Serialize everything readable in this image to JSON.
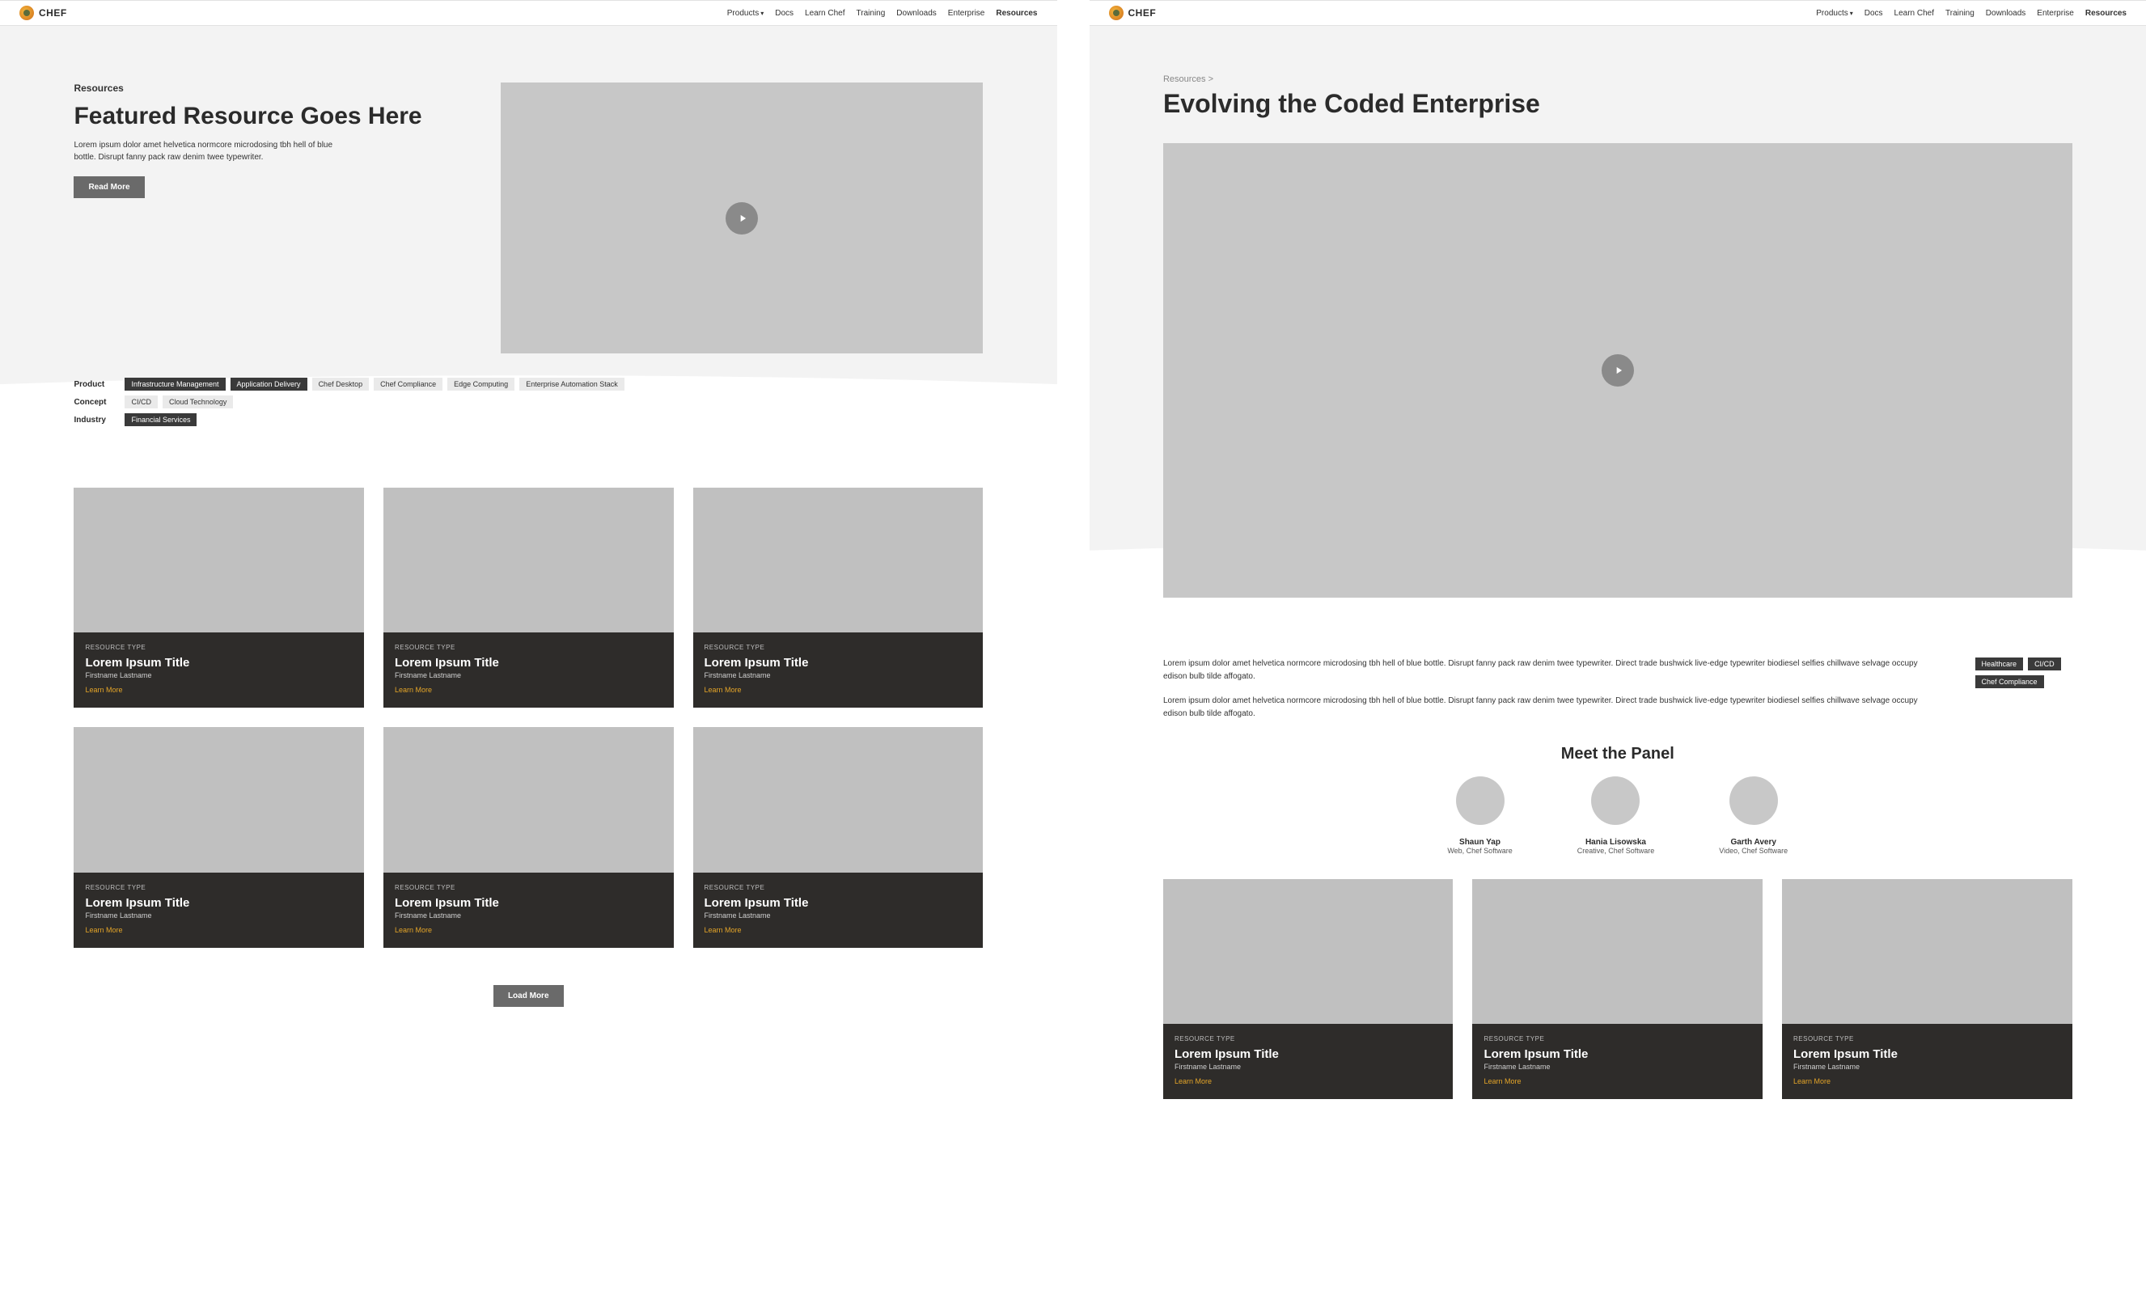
{
  "nav": {
    "brand": "CHEF",
    "links": [
      {
        "label": "Products",
        "hasCaret": true
      },
      {
        "label": "Docs"
      },
      {
        "label": "Learn Chef"
      },
      {
        "label": "Training"
      },
      {
        "label": "Downloads"
      },
      {
        "label": "Enterprise"
      },
      {
        "label": "Resources",
        "active": true
      }
    ]
  },
  "left": {
    "breadcrumb": "Resources",
    "title": "Featured Resource Goes Here",
    "lead": "Lorem ipsum dolor amet helvetica normcore microdosing tbh hell of blue bottle. Disrupt fanny pack raw denim twee typewriter.",
    "readMore": "Read More",
    "filters": {
      "product": {
        "label": "Product",
        "tags": [
          {
            "text": "Infrastructure Management",
            "dark": true
          },
          {
            "text": "Application Delivery",
            "dark": true
          },
          {
            "text": "Chef Desktop"
          },
          {
            "text": "Chef Compliance"
          },
          {
            "text": "Edge Computing"
          },
          {
            "text": "Enterprise Automation Stack"
          }
        ]
      },
      "concept": {
        "label": "Concept",
        "tags": [
          {
            "text": "CI/CD"
          },
          {
            "text": "Cloud Technology"
          }
        ]
      },
      "industry": {
        "label": "Industry",
        "tags": [
          {
            "text": "Financial Services",
            "dark": true
          }
        ]
      }
    },
    "cards": [
      {
        "type": "RESOURCE TYPE",
        "title": "Lorem Ipsum Title",
        "author": "Firstname Lastname",
        "link": "Learn More"
      },
      {
        "type": "RESOURCE TYPE",
        "title": "Lorem Ipsum Title",
        "author": "Firstname Lastname",
        "link": "Learn More"
      },
      {
        "type": "RESOURCE TYPE",
        "title": "Lorem Ipsum Title",
        "author": "Firstname Lastname",
        "link": "Learn More"
      },
      {
        "type": "RESOURCE TYPE",
        "title": "Lorem Ipsum Title",
        "author": "Firstname Lastname",
        "link": "Learn More"
      },
      {
        "type": "RESOURCE TYPE",
        "title": "Lorem Ipsum Title",
        "author": "Firstname Lastname",
        "link": "Learn More"
      },
      {
        "type": "RESOURCE TYPE",
        "title": "Lorem Ipsum Title",
        "author": "Firstname Lastname",
        "link": "Learn More"
      }
    ],
    "loadMore": "Load More"
  },
  "right": {
    "breadcrumb": "Resources >",
    "title": "Evolving the Coded Enterprise",
    "paras": [
      "Lorem ipsum dolor amet helvetica normcore microdosing tbh hell of blue bottle. Disrupt fanny pack raw denim twee typewriter. Direct trade bushwick live-edge typewriter biodiesel selfies chillwave selvage occupy edison bulb tilde affogato.",
      "Lorem ipsum dolor amet helvetica normcore microdosing tbh hell of blue bottle. Disrupt fanny pack raw denim twee typewriter. Direct trade bushwick live-edge typewriter biodiesel selfies chillwave selvage occupy edison bulb tilde affogato."
    ],
    "tags": [
      {
        "text": "Healthcare",
        "dark": true
      },
      {
        "text": "CI/CD",
        "dark": true
      },
      {
        "text": "Chef Compliance",
        "dark": true
      }
    ],
    "panelTitle": "Meet the Panel",
    "panel": [
      {
        "name": "Shaun Yap",
        "role": "Web, Chef Software"
      },
      {
        "name": "Hania Lisowska",
        "role": "Creative, Chef Software"
      },
      {
        "name": "Garth Avery",
        "role": "Video, Chef Software"
      }
    ],
    "cards": [
      {
        "type": "RESOURCE TYPE",
        "title": "Lorem Ipsum Title",
        "author": "Firstname Lastname",
        "link": "Learn More"
      },
      {
        "type": "RESOURCE TYPE",
        "title": "Lorem Ipsum Title",
        "author": "Firstname Lastname",
        "link": "Learn More"
      },
      {
        "type": "RESOURCE TYPE",
        "title": "Lorem Ipsum Title",
        "author": "Firstname Lastname",
        "link": "Learn More"
      }
    ]
  }
}
